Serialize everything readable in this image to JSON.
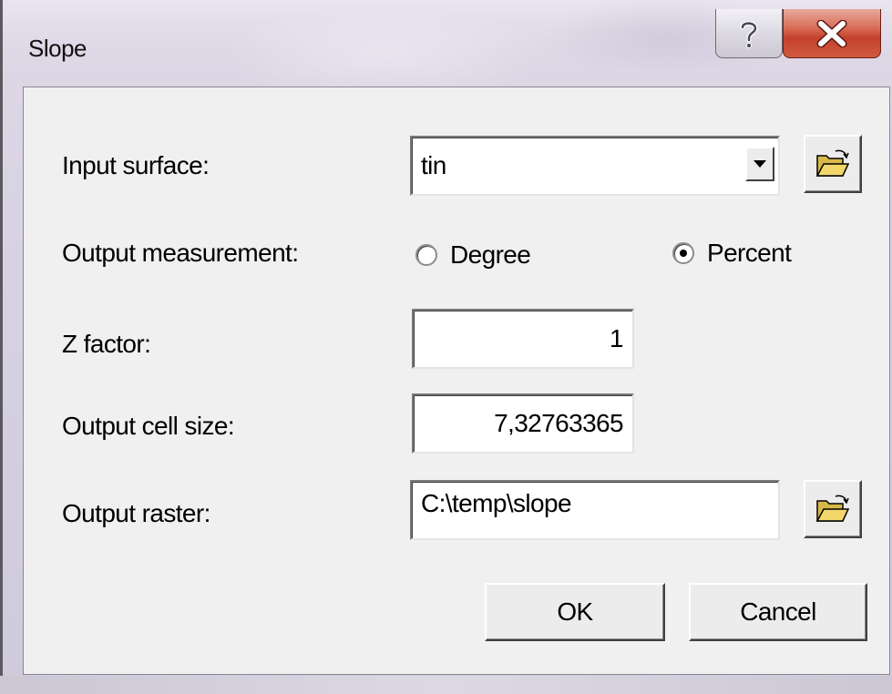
{
  "window": {
    "title": "Slope",
    "help_glyph": "?",
    "close_glyph": "x"
  },
  "form": {
    "input_surface": {
      "label": "Input surface:",
      "value": "tin"
    },
    "output_measurement": {
      "label": "Output measurement:",
      "options": [
        {
          "label": "Degree",
          "selected": false
        },
        {
          "label": "Percent",
          "selected": true
        }
      ]
    },
    "z_factor": {
      "label": "Z factor:",
      "value": "1"
    },
    "output_cell_size": {
      "label": "Output cell size:",
      "value": "7,32763365"
    },
    "output_raster": {
      "label": "Output raster:",
      "value": "C:\\temp\\slope"
    }
  },
  "buttons": {
    "ok": "OK",
    "cancel": "Cancel"
  },
  "icons": {
    "help": "question-icon",
    "close": "close-icon",
    "browse": "open-folder-icon",
    "dropdown": "chevron-down-icon"
  },
  "colors": {
    "close_button": "#c4402a",
    "dialog_bg": "#f0f0f0"
  }
}
